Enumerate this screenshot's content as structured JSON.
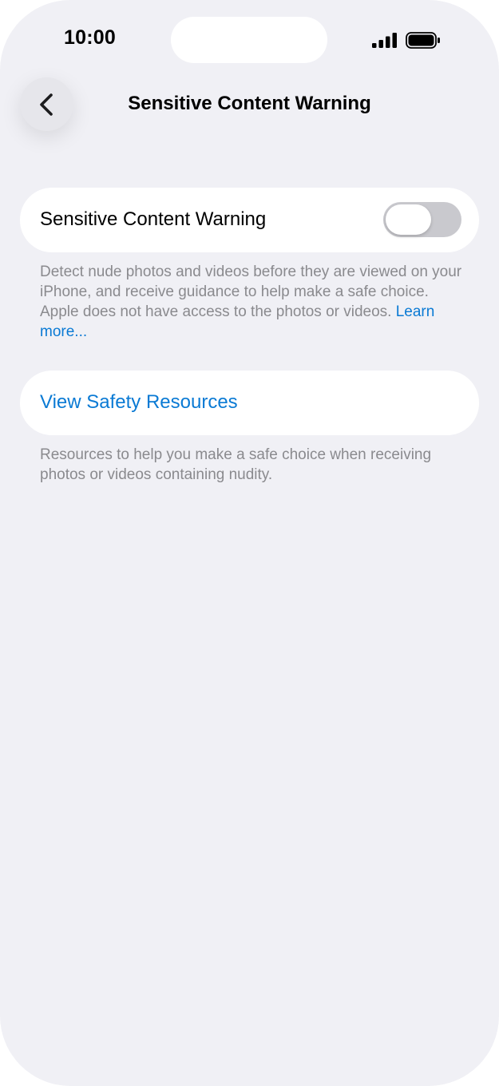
{
  "status_bar": {
    "time": "10:00",
    "signal_icon": "cellular-signal-icon",
    "battery_icon": "battery-icon"
  },
  "nav": {
    "back_icon": "chevron-left-icon",
    "title": "Sensitive Content Warning"
  },
  "toggle_row": {
    "label": "Sensitive Content Warning",
    "enabled": false
  },
  "toggle_footnote": {
    "text": "Detect nude photos and videos before they are viewed on your iPhone, and receive guidance to help make a safe choice. Apple does not have access to the photos or videos.",
    "link": "Learn more..."
  },
  "resources_row": {
    "label": "View Safety Resources"
  },
  "resources_footnote": {
    "text": "Resources to help you make a safe choice when receiving photos or videos containing nudity."
  },
  "colors": {
    "background": "#f0f0f5",
    "accent": "#0a7ad4",
    "secondary_text": "#8a8a8e",
    "toggle_off": "#c9c9ce"
  }
}
